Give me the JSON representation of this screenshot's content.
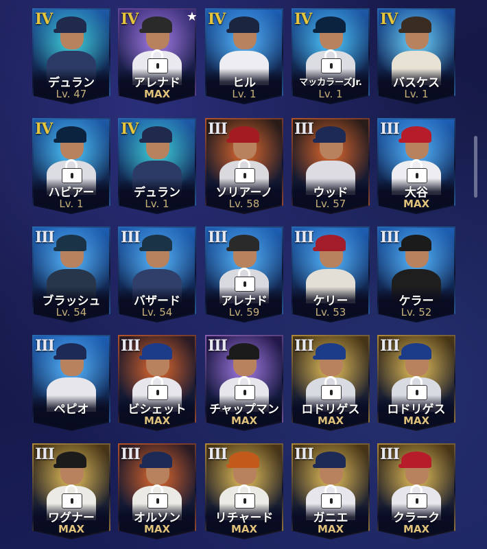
{
  "cards": [
    {
      "tier": "IV",
      "name": "デュラン",
      "level": "Lv. 47",
      "locked": false,
      "star": false,
      "frame": "#2a6ab0",
      "bg": "#1e5aa8",
      "glow": "#3fd1d9",
      "cap": "#1f2a4d",
      "body": "#2c3b66"
    },
    {
      "tier": "IV",
      "name": "アレナド",
      "level": "MAX",
      "locked": true,
      "star": true,
      "frame": "#6a4a9a",
      "bg": "#3b2f7a",
      "glow": "#a77de8",
      "cap": "#2a2a2a",
      "body": "#e9e9ef"
    },
    {
      "tier": "IV",
      "name": "ヒル",
      "level": "Lv. 1",
      "locked": false,
      "star": false,
      "frame": "#2a6ab0",
      "bg": "#1d5fb5",
      "glow": "#56b7ff",
      "cap": "#1c2540",
      "body": "#eeeef2"
    },
    {
      "tier": "IV",
      "name": "マッカラーズJr.",
      "level": "Lv. 1",
      "locked": true,
      "star": false,
      "frame": "#2a6ab0",
      "bg": "#1e5aa8",
      "glow": "#4ec9ff",
      "cap": "#0c2340",
      "body": "#dcdde3"
    },
    {
      "tier": "IV",
      "name": "バスケス",
      "level": "Lv. 1",
      "locked": false,
      "star": false,
      "frame": "#2a6ab0",
      "bg": "#1a4f9e",
      "glow": "#6fd6ff",
      "cap": "#3b2c22",
      "body": "#e8e2d5"
    },
    {
      "tier": "IV",
      "name": "ハビアー",
      "level": "Lv. 1",
      "locked": true,
      "star": false,
      "frame": "#2a6ab0",
      "bg": "#1e5aa8",
      "glow": "#4ec9ff",
      "cap": "#0c2340",
      "body": "#dcdde3"
    },
    {
      "tier": "IV",
      "name": "デュラン",
      "level": "Lv. 1",
      "locked": false,
      "star": false,
      "frame": "#2a6ab0",
      "bg": "#1e5aa8",
      "glow": "#3fd1d9",
      "cap": "#1f2a4d",
      "body": "#2c3b66"
    },
    {
      "tier": "III",
      "name": "ソリアーノ",
      "level": "Lv. 58",
      "locked": true,
      "star": false,
      "frame": "#b5542a",
      "bg": "#2a1c16",
      "glow": "#e36a2e",
      "cap": "#a31c22",
      "body": "#d9d9de"
    },
    {
      "tier": "III",
      "name": "ウッド",
      "level": "Lv. 57",
      "locked": false,
      "star": false,
      "frame": "#b5542a",
      "bg": "#2a1c16",
      "glow": "#e36a2e",
      "cap": "#1c2a55",
      "body": "#dcdce2"
    },
    {
      "tier": "III",
      "name": "大谷",
      "level": "MAX",
      "locked": true,
      "star": false,
      "frame": "#2a6ab0",
      "bg": "#1d5fb5",
      "glow": "#56b7ff",
      "cap": "#b71c2a",
      "body": "#eeeef2"
    },
    {
      "tier": "III",
      "name": "ブラッシュ",
      "level": "Lv. 54",
      "locked": false,
      "star": false,
      "frame": "#2a6ab0",
      "bg": "#1d5fb5",
      "glow": "#56b7ff",
      "cap": "#1b3346",
      "body": "#27364a"
    },
    {
      "tier": "III",
      "name": "バザード",
      "level": "Lv. 54",
      "locked": false,
      "star": false,
      "frame": "#2a6ab0",
      "bg": "#1d5fb5",
      "glow": "#56b7ff",
      "cap": "#1b3346",
      "body": "#2f3f6a"
    },
    {
      "tier": "III",
      "name": "アレナド",
      "level": "Lv. 59",
      "locked": true,
      "star": false,
      "frame": "#2a6ab0",
      "bg": "#1d5fb5",
      "glow": "#56b7ff",
      "cap": "#2a2a2a",
      "body": "#d9d9e0"
    },
    {
      "tier": "III",
      "name": "ケリー",
      "level": "Lv. 53",
      "locked": false,
      "star": false,
      "frame": "#2a6ab0",
      "bg": "#1d5fb5",
      "glow": "#56b7ff",
      "cap": "#a31c2a",
      "body": "#e3dfd6"
    },
    {
      "tier": "III",
      "name": "ケラー",
      "level": "Lv. 52",
      "locked": false,
      "star": false,
      "frame": "#2a6ab0",
      "bg": "#1d5fb5",
      "glow": "#56b7ff",
      "cap": "#1b1b1b",
      "body": "#1e1e1e"
    },
    {
      "tier": "III",
      "name": "ペピオ",
      "level": "",
      "locked": false,
      "star": false,
      "frame": "#2a6ab0",
      "bg": "#1d5fb5",
      "glow": "#56b7ff",
      "cap": "#1c2a55",
      "body": "#e6e6ec"
    },
    {
      "tier": "III",
      "name": "ビシェット",
      "level": "MAX",
      "locked": true,
      "star": false,
      "frame": "#b5542a",
      "bg": "#2a1a22",
      "glow": "#e36a2e",
      "cap": "#1c3b88",
      "body": "#e6e6ec"
    },
    {
      "tier": "III",
      "name": "チャップマン",
      "level": "MAX",
      "locked": true,
      "star": false,
      "frame": "#8a5fb0",
      "bg": "#24184a",
      "glow": "#a77de8",
      "cap": "#1b1b1b",
      "body": "#e6e6ec"
    },
    {
      "tier": "III",
      "name": "ロドリゲス",
      "level": "MAX",
      "locked": true,
      "star": false,
      "frame": "#b08a3a",
      "bg": "#4a3614",
      "glow": "#e8c25a",
      "cap": "#1c3b88",
      "body": "#d9dbe3"
    },
    {
      "tier": "III",
      "name": "ロドリゲス",
      "level": "MAX",
      "locked": true,
      "star": false,
      "frame": "#b08a3a",
      "bg": "#4a3614",
      "glow": "#e8c25a",
      "cap": "#1c3b88",
      "body": "#d9dbe3"
    },
    {
      "tier": "III",
      "name": "ワグナー",
      "level": "MAX",
      "locked": true,
      "star": false,
      "frame": "#b08a3a",
      "bg": "#4a3614",
      "glow": "#e8c25a",
      "cap": "#1b1b1b",
      "body": "#eceae4"
    },
    {
      "tier": "III",
      "name": "オルソン",
      "level": "MAX",
      "locked": true,
      "star": false,
      "frame": "#b5542a",
      "bg": "#2a1a22",
      "glow": "#e36a2e",
      "cap": "#1c2a55",
      "body": "#eceae4"
    },
    {
      "tier": "III",
      "name": "リチャード",
      "level": "MAX",
      "locked": true,
      "star": false,
      "frame": "#b08a3a",
      "bg": "#4a3614",
      "glow": "#e8c25a",
      "cap": "#c25a1c",
      "body": "#eceae4"
    },
    {
      "tier": "III",
      "name": "ガニエ",
      "level": "MAX",
      "locked": true,
      "star": false,
      "frame": "#b08a3a",
      "bg": "#4a3614",
      "glow": "#e8c25a",
      "cap": "#1c2a55",
      "body": "#e6e6ec"
    },
    {
      "tier": "III",
      "name": "クラーク",
      "level": "MAX",
      "locked": true,
      "star": false,
      "frame": "#b08a3a",
      "bg": "#4a3614",
      "glow": "#e8c25a",
      "cap": "#b71c2a",
      "body": "#e6e6ec"
    }
  ]
}
